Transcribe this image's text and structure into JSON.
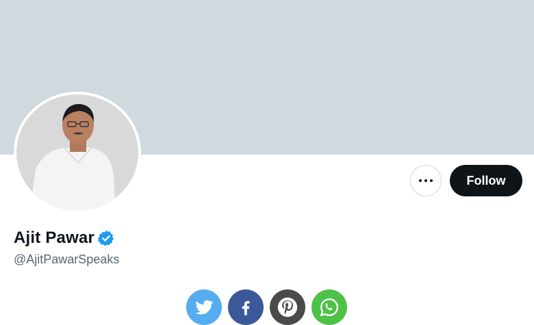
{
  "profile": {
    "display_name": "Ajit Pawar",
    "handle": "@AjitPawarSpeaks",
    "verified": true
  },
  "actions": {
    "follow_label": "Follow",
    "more_icon": "more-horizontal-icon"
  },
  "share": [
    {
      "name": "twitter",
      "icon": "twitter-icon",
      "color": "#55acee"
    },
    {
      "name": "facebook",
      "icon": "facebook-icon",
      "color": "#3b5998"
    },
    {
      "name": "pinterest",
      "icon": "pinterest-icon",
      "color": "#4a4a4a"
    },
    {
      "name": "whatsapp",
      "icon": "whatsapp-icon",
      "color": "#4dc247"
    }
  ],
  "colors": {
    "banner": "#cfd9de",
    "follow_bg": "#0f1419",
    "verified": "#1d9bf0",
    "handle": "#536471"
  }
}
